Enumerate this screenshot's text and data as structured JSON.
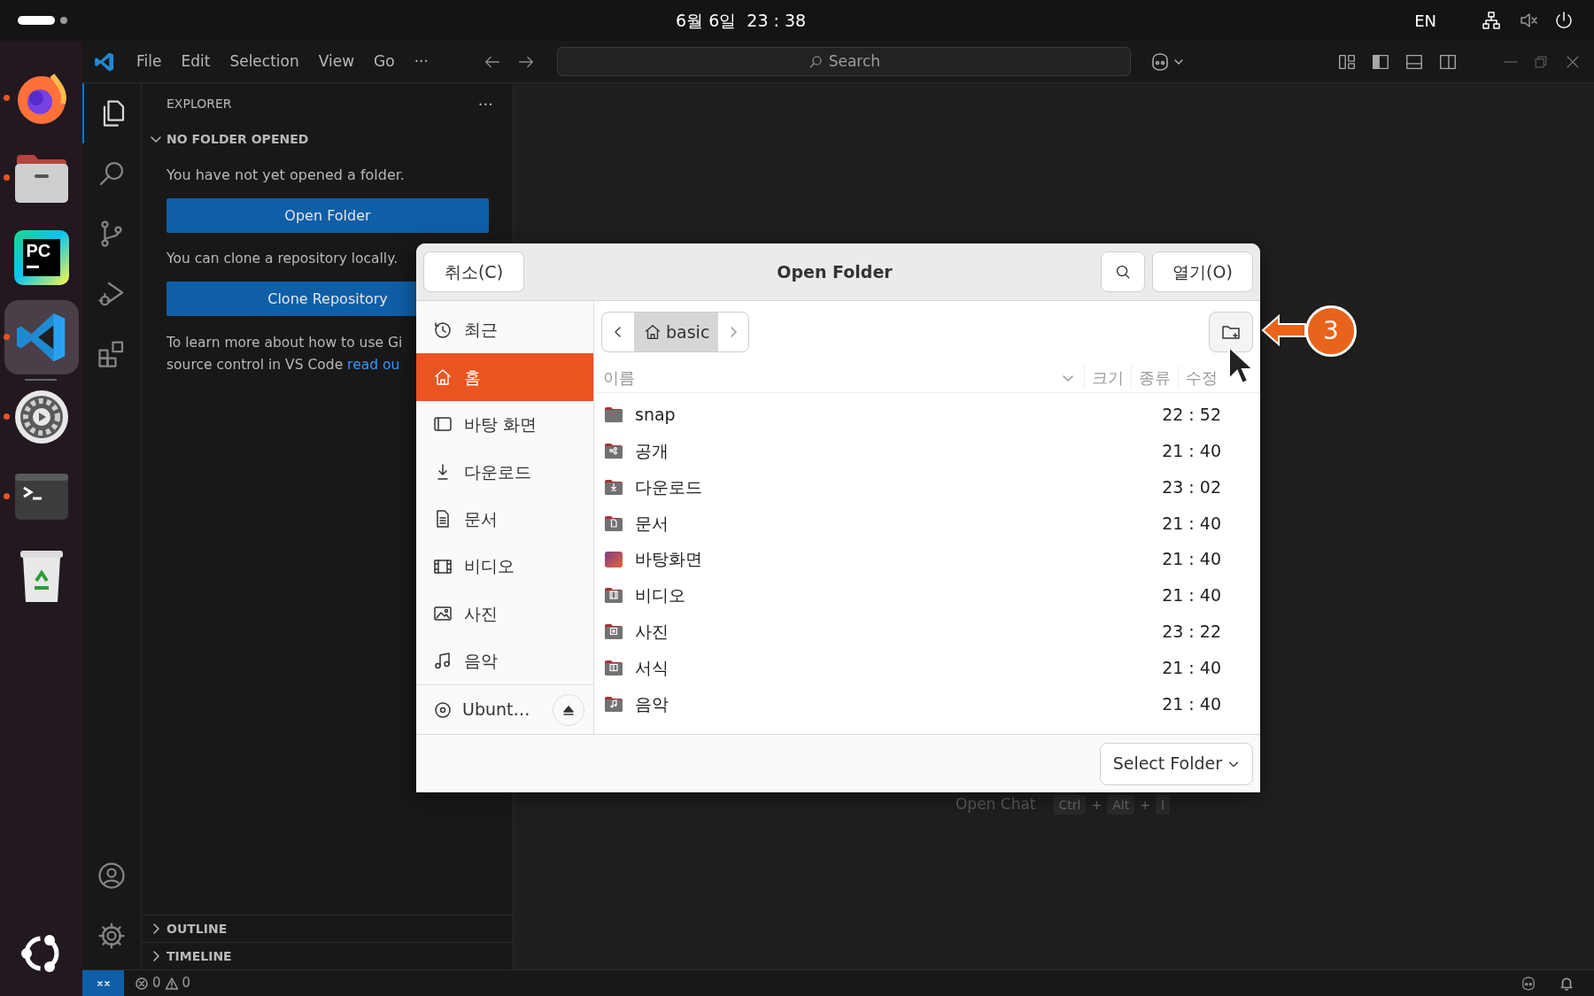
{
  "top_bar": {
    "clock": "6월 6일  23 : 38",
    "language": "EN"
  },
  "dock": [
    {
      "kind": "firefox",
      "running": true,
      "selected": false
    },
    {
      "kind": "files",
      "running": true,
      "selected": false
    },
    {
      "kind": "pycharm",
      "logo_text": "PC",
      "running": false,
      "selected": false
    },
    {
      "kind": "vscode",
      "running": true,
      "selected": true
    },
    {
      "kind": "settings",
      "running": true,
      "selected": false
    },
    {
      "kind": "terminal",
      "running": true,
      "selected": false
    },
    {
      "kind": "trash",
      "running": false,
      "selected": false
    }
  ],
  "vscode": {
    "menu": [
      "File",
      "Edit",
      "Selection",
      "View",
      "Go",
      "···"
    ],
    "search_placeholder": "Search",
    "activity_bar": [
      {
        "kind": "explorer",
        "selected": true
      },
      {
        "kind": "search",
        "selected": false
      },
      {
        "kind": "scm",
        "selected": false
      },
      {
        "kind": "debug",
        "selected": false
      },
      {
        "kind": "extensions",
        "selected": false
      }
    ],
    "explorer": {
      "title": "EXPLORER",
      "more": "···",
      "section": {
        "label": "NO FOLDER OPENED",
        "expanded": true
      },
      "message": "You have not yet opened a folder.",
      "open_button": "Open Folder",
      "clone_message": "You can clone a repository locally.",
      "clone_button": "Clone Repository",
      "learn_lines": [
        "To learn more about how to use Gi",
        "source control in VS Code"
      ],
      "learn_link": "read ou"
    },
    "bottom_sections": [
      {
        "label": "OUTLINE",
        "expanded": false
      },
      {
        "label": "TIMELINE",
        "expanded": false
      }
    ],
    "editor_hint": {
      "label": "Open Chat",
      "shortcut": [
        {
          "kind": "key",
          "text": "Ctrl"
        },
        {
          "kind": "plus",
          "text": "+"
        },
        {
          "kind": "key",
          "text": "Alt"
        },
        {
          "kind": "plus",
          "text": "+"
        },
        {
          "kind": "key",
          "text": "I"
        }
      ]
    },
    "status_bar": {
      "errors": "0",
      "warnings": "0"
    }
  },
  "dialog": {
    "title": "Open Folder",
    "cancel": "취소(C)",
    "open": "열기(O)",
    "path": "basic",
    "places": [
      {
        "kind": "recent",
        "label": "최근",
        "selected": false
      },
      {
        "kind": "home",
        "label": "홈",
        "selected": true
      },
      {
        "kind": "desktop",
        "label": "바탕 화면",
        "selected": false
      },
      {
        "kind": "download",
        "label": "다운로드",
        "selected": false
      },
      {
        "kind": "document",
        "label": "문서",
        "selected": false
      },
      {
        "kind": "video",
        "label": "비디오",
        "selected": false
      },
      {
        "kind": "pictures",
        "label": "사진",
        "selected": false
      },
      {
        "kind": "music",
        "label": "음악",
        "selected": false
      },
      {
        "kind": "drive",
        "label": "Ubunt…",
        "selected": false
      }
    ],
    "columns": [
      "이름",
      "크기",
      "종류",
      "수정"
    ],
    "rows": [
      {
        "kind": "folder",
        "name": "snap",
        "modified": "22 : 52"
      },
      {
        "kind": "share",
        "name": "공개",
        "modified": "21 : 40"
      },
      {
        "kind": "download",
        "name": "다운로드",
        "modified": "23 : 02"
      },
      {
        "kind": "document",
        "name": "문서",
        "modified": "21 : 40"
      },
      {
        "kind": "desktop",
        "name": "바탕화면",
        "modified": "21 : 40"
      },
      {
        "kind": "video",
        "name": "비디오",
        "modified": "21 : 40"
      },
      {
        "kind": "pictures",
        "name": "사진",
        "modified": "23 : 22"
      },
      {
        "kind": "templates",
        "name": "서식",
        "modified": "21 : 40"
      },
      {
        "kind": "music",
        "name": "음악",
        "modified": "21 : 40"
      }
    ],
    "filter": "Select Folder"
  },
  "annotation": {
    "number": "3"
  }
}
